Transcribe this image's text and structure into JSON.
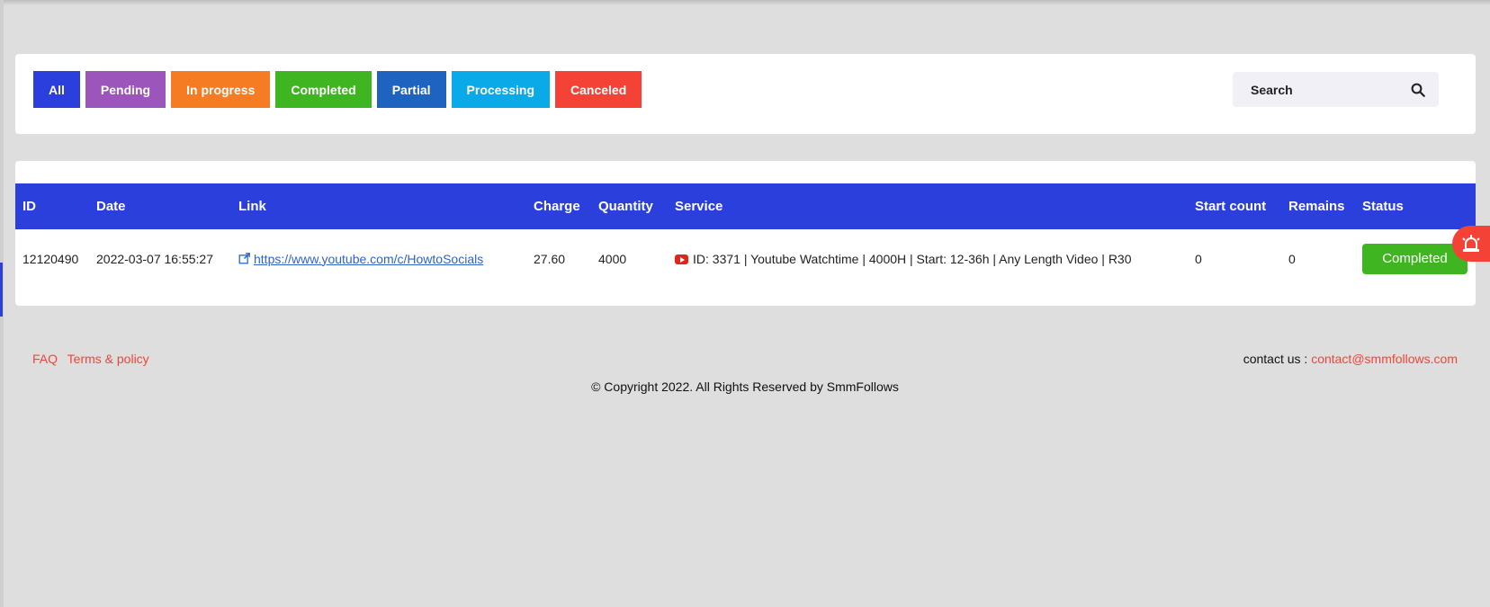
{
  "filters": [
    {
      "label": "All",
      "color": "#2a3fdc"
    },
    {
      "label": "Pending",
      "color": "#9c55bb"
    },
    {
      "label": "In progress",
      "color": "#f57c22"
    },
    {
      "label": "Completed",
      "color": "#3fb521"
    },
    {
      "label": "Partial",
      "color": "#1e63bf"
    },
    {
      "label": "Processing",
      "color": "#0aa9e8"
    },
    {
      "label": "Canceled",
      "color": "#f44336"
    }
  ],
  "search": {
    "placeholder": "Search",
    "icon": "search-icon"
  },
  "table": {
    "headers": [
      "ID",
      "Date",
      "Link",
      "Charge",
      "Quantity",
      "Service",
      "Start count",
      "Remains",
      "Status"
    ],
    "rows": [
      {
        "id": "12120490",
        "date": "2022-03-07 16:55:27",
        "link": "https://www.youtube.com/c/HowtoSocials",
        "charge": "27.60",
        "quantity": "4000",
        "service": "ID: 3371 | Youtube Watchtime | 4000H | Start: 12-36h | Any Length Video | R30",
        "start_count": "0",
        "remains": "0",
        "status": "Completed"
      }
    ]
  },
  "footer": {
    "faq": "FAQ",
    "terms": "Terms & policy",
    "contact_label": "contact us :",
    "contact_email": "contact@smmfollows.com",
    "copyright": "© Copyright 2022. All Rights Reserved by SmmFollows"
  },
  "colors": {
    "accent": "#2a3fdc",
    "completed": "#3fb521",
    "danger": "#f44336"
  }
}
